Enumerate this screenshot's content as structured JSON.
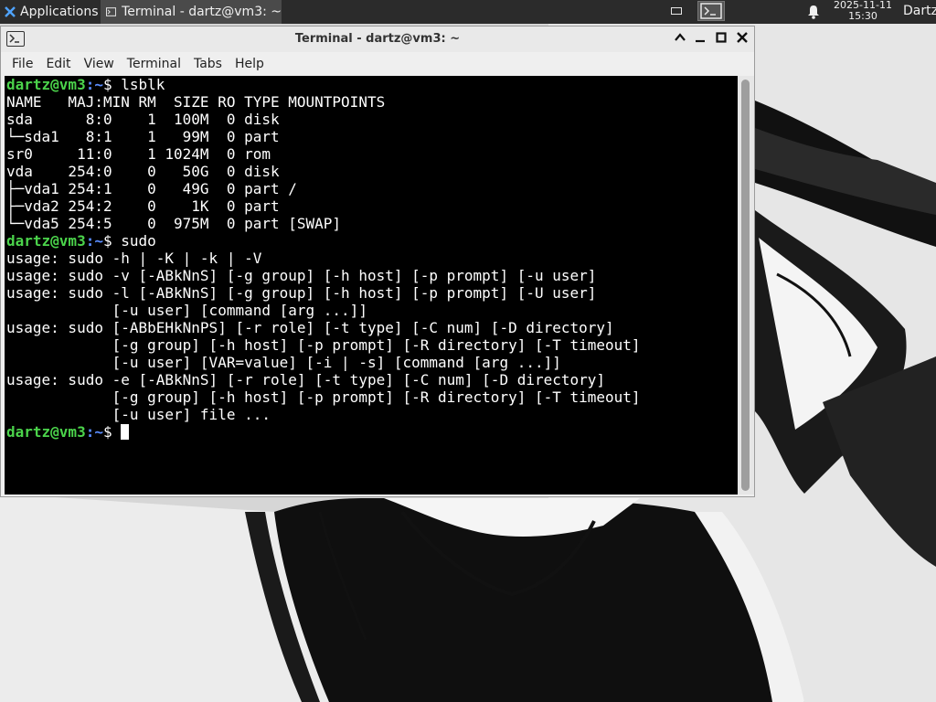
{
  "panel": {
    "apps_label": "Applications",
    "task_title": "Terminal - dartz@vm3: ~",
    "clock_date": "2025-11-11",
    "clock_time": "15:30",
    "user": "Dartz"
  },
  "window": {
    "title": "Terminal - dartz@vm3: ~",
    "menu": [
      "File",
      "Edit",
      "View",
      "Terminal",
      "Tabs",
      "Help"
    ]
  },
  "terminal": {
    "prompt_user": "dartz@vm3",
    "prompt_path": ":~",
    "prompt_symbol": "$ ",
    "cmd1": "lsblk",
    "lsblk_output": "NAME   MAJ:MIN RM  SIZE RO TYPE MOUNTPOINTS\nsda      8:0    1  100M  0 disk\n└─sda1   8:1    1   99M  0 part\nsr0     11:0    1 1024M  0 rom\nvda    254:0    0   50G  0 disk\n├─vda1 254:1    0   49G  0 part /\n├─vda2 254:2    0    1K  0 part\n└─vda5 254:5    0  975M  0 part [SWAP]",
    "cmd2": "sudo",
    "sudo_output": "usage: sudo -h | -K | -k | -V\nusage: sudo -v [-ABkNnS] [-g group] [-h host] [-p prompt] [-u user]\nusage: sudo -l [-ABkNnS] [-g group] [-h host] [-p prompt] [-U user]\n            [-u user] [command [arg ...]]\nusage: sudo [-ABbEHkNnPS] [-r role] [-t type] [-C num] [-D directory]\n            [-g group] [-h host] [-p prompt] [-R directory] [-T timeout]\n            [-u user] [VAR=value] [-i | -s] [command [arg ...]]\nusage: sudo -e [-ABkNnS] [-r role] [-t type] [-C num] [-D directory]\n            [-g group] [-h host] [-p prompt] [-R directory] [-T timeout]\n            [-u user] file ..."
  },
  "colors": {
    "prompt_user": "#4bd34b",
    "prompt_path": "#5a8dff",
    "terminal_bg": "#000000",
    "panel_bg": "#2b2b2b"
  },
  "icons": [
    "applications-icon",
    "terminal-icon",
    "minimize-window-icon",
    "terminal-indicator-icon",
    "bell-icon",
    "chevron-up-icon",
    "minimize-icon",
    "maximize-icon",
    "close-icon"
  ]
}
